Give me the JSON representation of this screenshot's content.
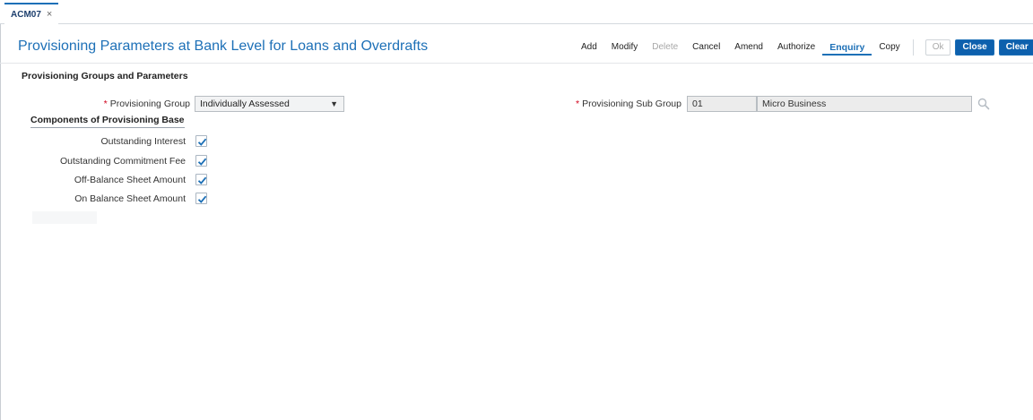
{
  "tab": {
    "label": "ACM07",
    "close": "×"
  },
  "page": {
    "title": "Provisioning Parameters at Bank Level for Loans and Overdrafts"
  },
  "toolbar": {
    "actions": [
      "Add",
      "Modify",
      "Delete",
      "Cancel",
      "Amend",
      "Authorize",
      "Enquiry",
      "Copy"
    ],
    "active_action": "Enquiry",
    "disabled_actions": [
      "Delete"
    ],
    "buttons": {
      "ok": "Ok",
      "close": "Close",
      "clear": "Clear"
    }
  },
  "section": {
    "title": "Provisioning Groups and Parameters"
  },
  "form": {
    "required_marker": "*",
    "provisioning_group": {
      "label": "Provisioning Group",
      "value": "Individually Assessed",
      "caret": "▼"
    },
    "provisioning_sub_group": {
      "label": "Provisioning Sub Group",
      "code": "01",
      "description": "Micro Business"
    }
  },
  "components": {
    "title": "Components of Provisioning Base",
    "items": [
      {
        "label": "Outstanding Interest",
        "checked": true
      },
      {
        "label": "Outstanding Commitment Fee",
        "checked": true
      },
      {
        "label": "Off-Balance Sheet Amount",
        "checked": true
      },
      {
        "label": "On Balance Sheet Amount",
        "checked": true
      }
    ]
  },
  "colors": {
    "accent": "#1d70b7",
    "primary_button": "#0d60ad",
    "required": "#d0021b"
  }
}
